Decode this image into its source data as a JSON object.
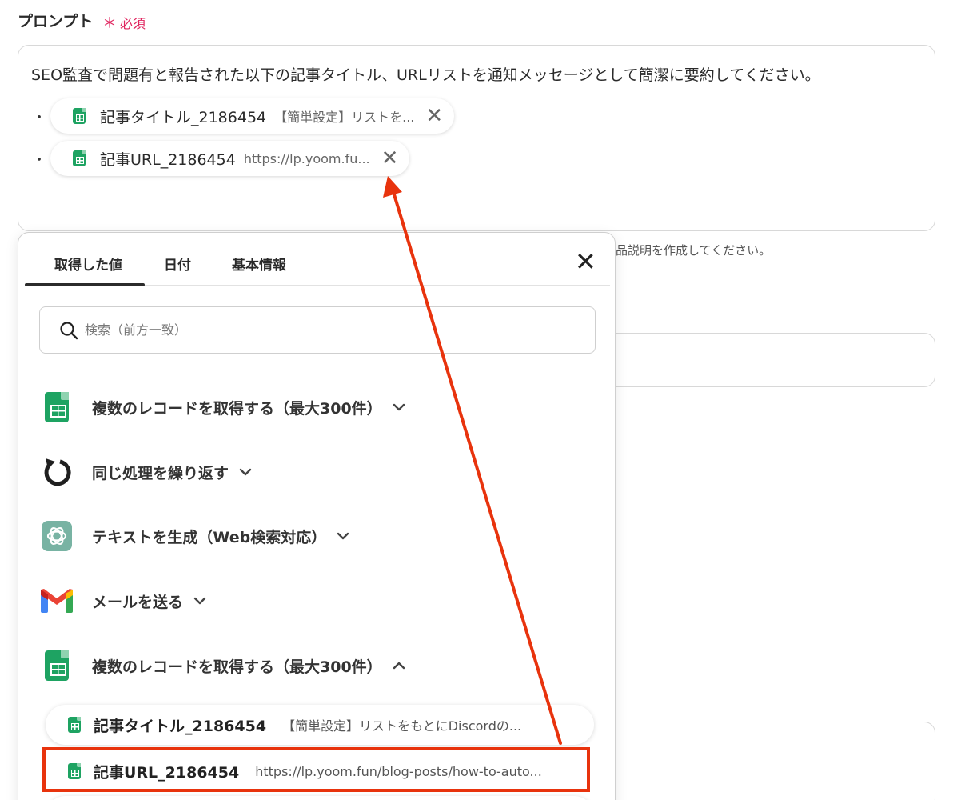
{
  "field": {
    "label": "プロンプト",
    "required_mark": "＊",
    "required_text": "必須"
  },
  "prompt": {
    "text": "SEO監査で問題有と報告された以下の記事タイトル、URLリストを通知メッセージとして簡潔に要約してください。",
    "bullet": "・",
    "chips": [
      {
        "name": "記事タイトル_2186454",
        "value": "【簡単設定】リストを...",
        "close": "✕"
      },
      {
        "name": "記事URL_2186454",
        "value": "https://lp.yoom.fu...",
        "close": "✕"
      }
    ]
  },
  "help_text": "品説明を作成してください。",
  "popup": {
    "tabs": [
      {
        "label": "取得した値"
      },
      {
        "label": "日付"
      },
      {
        "label": "基本情報"
      }
    ],
    "close": "✕",
    "search_placeholder": "検索（前方一致）",
    "groups": [
      {
        "label": "複数のレコードを取得する（最大300件）",
        "icon": "google-sheets-icon",
        "chevron": "down"
      },
      {
        "label": "同じ処理を繰り返す",
        "icon": "loop-icon",
        "chevron": "down"
      },
      {
        "label": "テキストを生成（Web検索対応）",
        "icon": "chatgpt-icon",
        "chevron": "down"
      },
      {
        "label": "メールを送る",
        "icon": "gmail-icon",
        "chevron": "down"
      },
      {
        "label": "複数のレコードを取得する（最大300件）",
        "icon": "google-sheets-icon",
        "chevron": "up"
      }
    ],
    "results": [
      {
        "name": "記事タイトル_2186454",
        "value": "【簡単設定】リストをもとにDiscordの..."
      },
      {
        "name": "記事URL_2186454",
        "value": "https://lp.yoom.fun/blog-posts/how-to-auto..."
      }
    ]
  },
  "colors": {
    "required": "#e0245e",
    "highlight": "#e8330d",
    "sheets_green": "#1ea362"
  }
}
